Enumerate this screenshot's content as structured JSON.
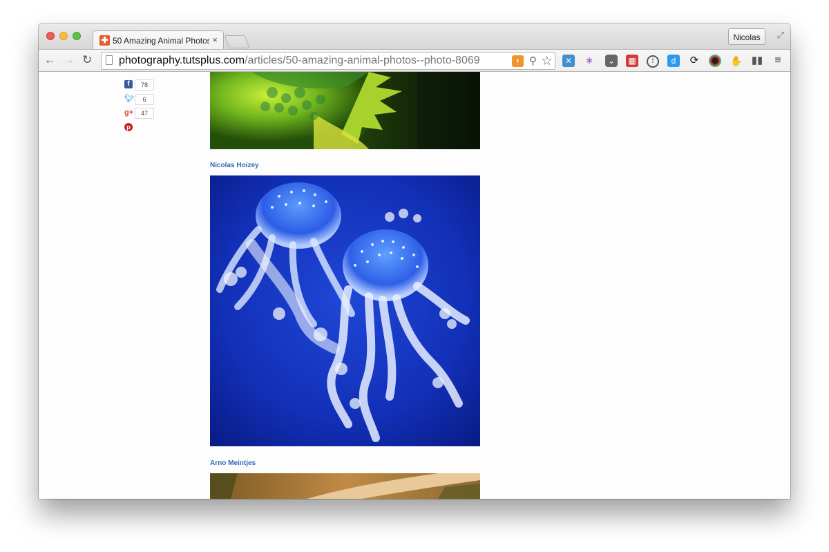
{
  "browser": {
    "tab_title": "50 Amazing Animal Photos",
    "tab_close": "×",
    "profile_name": "Nicolas",
    "url_host": "photography.tutsplus.com",
    "url_path": "/articles/50-amazing-animal-photos--photo-8069"
  },
  "extensions": [
    "feedly-icon",
    "pinwheel-icon",
    "pocket-icon",
    "gallery-icon",
    "1password-icon",
    "d-icon",
    "sync-icon",
    "color-picker-icon",
    "evernote-icon",
    "readability-icon",
    "menu-icon"
  ],
  "share": {
    "facebook_count": "78",
    "twitter_count": "6",
    "googleplus_count": "47"
  },
  "article": {
    "credit_1": "Nicolas Hoizey",
    "credit_2": "Arno Meintjes"
  },
  "colors": {
    "link": "#2c6bb6",
    "facebook": "#3b5998",
    "twitter": "#55acee",
    "googleplus": "#dd4b39",
    "pinterest": "#cb2027"
  }
}
